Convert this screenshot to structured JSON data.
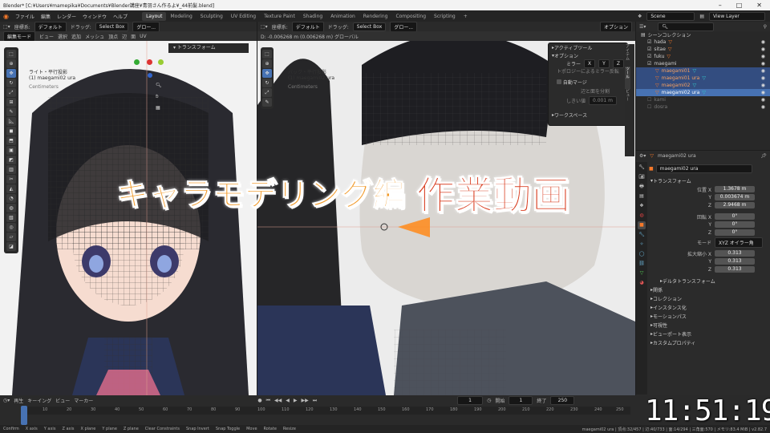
{
  "title_bar": {
    "title": "Blender* [C:¥Users¥mamepika¥Documents¥Blender講座¥青羽さん作るよ¥_44前髪.blend]",
    "minimize": "–",
    "maximize": "□",
    "close": "✕"
  },
  "menu": [
    "ファイル",
    "編集",
    "レンダー",
    "ウィンドウ",
    "ヘルプ"
  ],
  "workspaces": [
    "Layout",
    "Modeling",
    "Sculpting",
    "UV Editing",
    "Texture Paint",
    "Shading",
    "Animation",
    "Rendering",
    "Compositing",
    "Scripting",
    "+"
  ],
  "scene": {
    "label": "Scene",
    "view_layer": "View Layer"
  },
  "left_header": {
    "mode": "編集モード",
    "items": [
      "ビュー",
      "選択",
      "追加",
      "メッシュ",
      "頂点",
      "辺",
      "面",
      "UV"
    ],
    "coord": "座標系:",
    "coord_val": "デフォルト",
    "drag": "ドラッグ:",
    "select": "Select Box",
    "global": "グロー..."
  },
  "left_vp": {
    "title": "ライト・平行投影",
    "object": "(1) maegami02 ura",
    "units": "Centimeters",
    "side_panel_title": "トランスフォーム"
  },
  "right_vp": {
    "header_measure": "D: -0.006268 m (0.006268 m) グローバル",
    "title": "バック・平行投影",
    "object": "(1) maegami02 ura",
    "units": "Centimeters",
    "option_btn": "オプション"
  },
  "options_popup": {
    "active_tool": "アクティブツール",
    "options": "オプション",
    "mirror": "ミラー",
    "mirror_x": "X",
    "mirror_y": "Y",
    "mirror_z": "Z",
    "topology_mirror": "トポロジーによるミラー反転",
    "auto_merge": "自動マージ",
    "split_edges": "辺と面を分割",
    "threshold_label": "しきい値",
    "threshold": "0.001 m",
    "workspace": "ワークスペース"
  },
  "outliner": {
    "title": "シーンコレクション",
    "rows": [
      {
        "name": "hada",
        "sel": false
      },
      {
        "name": "sitae",
        "sel": false
      },
      {
        "name": "fuku",
        "sel": false
      },
      {
        "name": "maegami",
        "sel": false
      },
      {
        "name": "maegami01",
        "sel": true
      },
      {
        "name": "maegami01 ura",
        "sel": true
      },
      {
        "name": "maegami02",
        "sel": true
      },
      {
        "name": "maegami02 ura",
        "sel": true
      },
      {
        "name": "kami",
        "sel": false
      },
      {
        "name": "dosra",
        "sel": false
      }
    ]
  },
  "properties": {
    "object_name": "maegami02 ura",
    "object_field": "maegami02 ura",
    "transform": "トランスフォーム",
    "loc_label": "位置 X",
    "loc": [
      "1.3678 m",
      "0.003674 m",
      "2.9468 m"
    ],
    "rot_label": "回転 X",
    "rot": [
      "0°",
      "0°",
      "0°"
    ],
    "mode_label": "モード",
    "mode": "XYZ オイラー角",
    "scale_label": "拡大縮小 X",
    "scale": [
      "0.313",
      "0.313",
      "0.313"
    ],
    "axis_y": "Y",
    "axis_z": "Z",
    "sections": [
      "デルタトランスフォーム",
      "関係",
      "コレクション",
      "インスタンス化",
      "モーションパス",
      "可視性",
      "ビューポート表示",
      "カスタムプロパティ"
    ]
  },
  "timeline": {
    "items": [
      "再生",
      "キーイング",
      "ビュー",
      "マーカー"
    ],
    "current": "1",
    "start_label": "開始",
    "start": "1",
    "end_label": "終了",
    "end": "250",
    "ticks": [
      "1",
      "10",
      "20",
      "30",
      "40",
      "50",
      "60",
      "70",
      "80",
      "90",
      "100",
      "110",
      "120",
      "130",
      "140",
      "150",
      "160",
      "170",
      "180",
      "190",
      "200",
      "210",
      "220",
      "230",
      "240",
      "250"
    ]
  },
  "status": {
    "items": [
      "Confirm",
      "X axis",
      "Y axis",
      "Z axis",
      "X plane",
      "Y plane",
      "Z plane",
      "Clear Constraints",
      "Snap Invert",
      "Snap Toggle",
      "Move",
      "Rotate",
      "Resize"
    ],
    "right": "maegami02 ura | 頂点:32/457 | 辺:40/733 | 面:14/294 | 三角面:570 | メモリ:83.4 MiB | v2.82.7"
  },
  "caption": {
    "part1": "キャラモデリング編",
    "part2": "作業動画"
  },
  "clock": "11:51:19",
  "colors": {
    "accent": "#4772b3",
    "orange": "#f19a2a",
    "red": "#d83a1c"
  }
}
